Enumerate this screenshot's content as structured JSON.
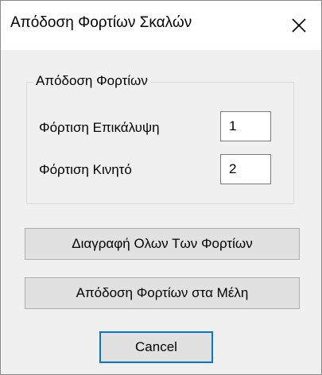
{
  "window": {
    "title": "Απόδοση Φορτίων Σκαλών",
    "close_icon": "close-icon"
  },
  "group": {
    "legend": "Απόδοση Φορτίων",
    "fields": [
      {
        "label": "Φόρτιση Επικάλυψη",
        "value": "1"
      },
      {
        "label": "Φόρτιση Κινητό",
        "value": "2"
      }
    ]
  },
  "buttons": {
    "delete_all": "Διαγραφή Ολων Των Φορτίων",
    "assign_to_members": "Απόδοση Φορτίων στα Μέλη",
    "cancel": "Cancel"
  },
  "colors": {
    "dialog_background": "#f0f0f0",
    "titlebar_background": "#ffffff",
    "default_button_border": "#0078d7",
    "button_background": "#e1e1e1"
  }
}
